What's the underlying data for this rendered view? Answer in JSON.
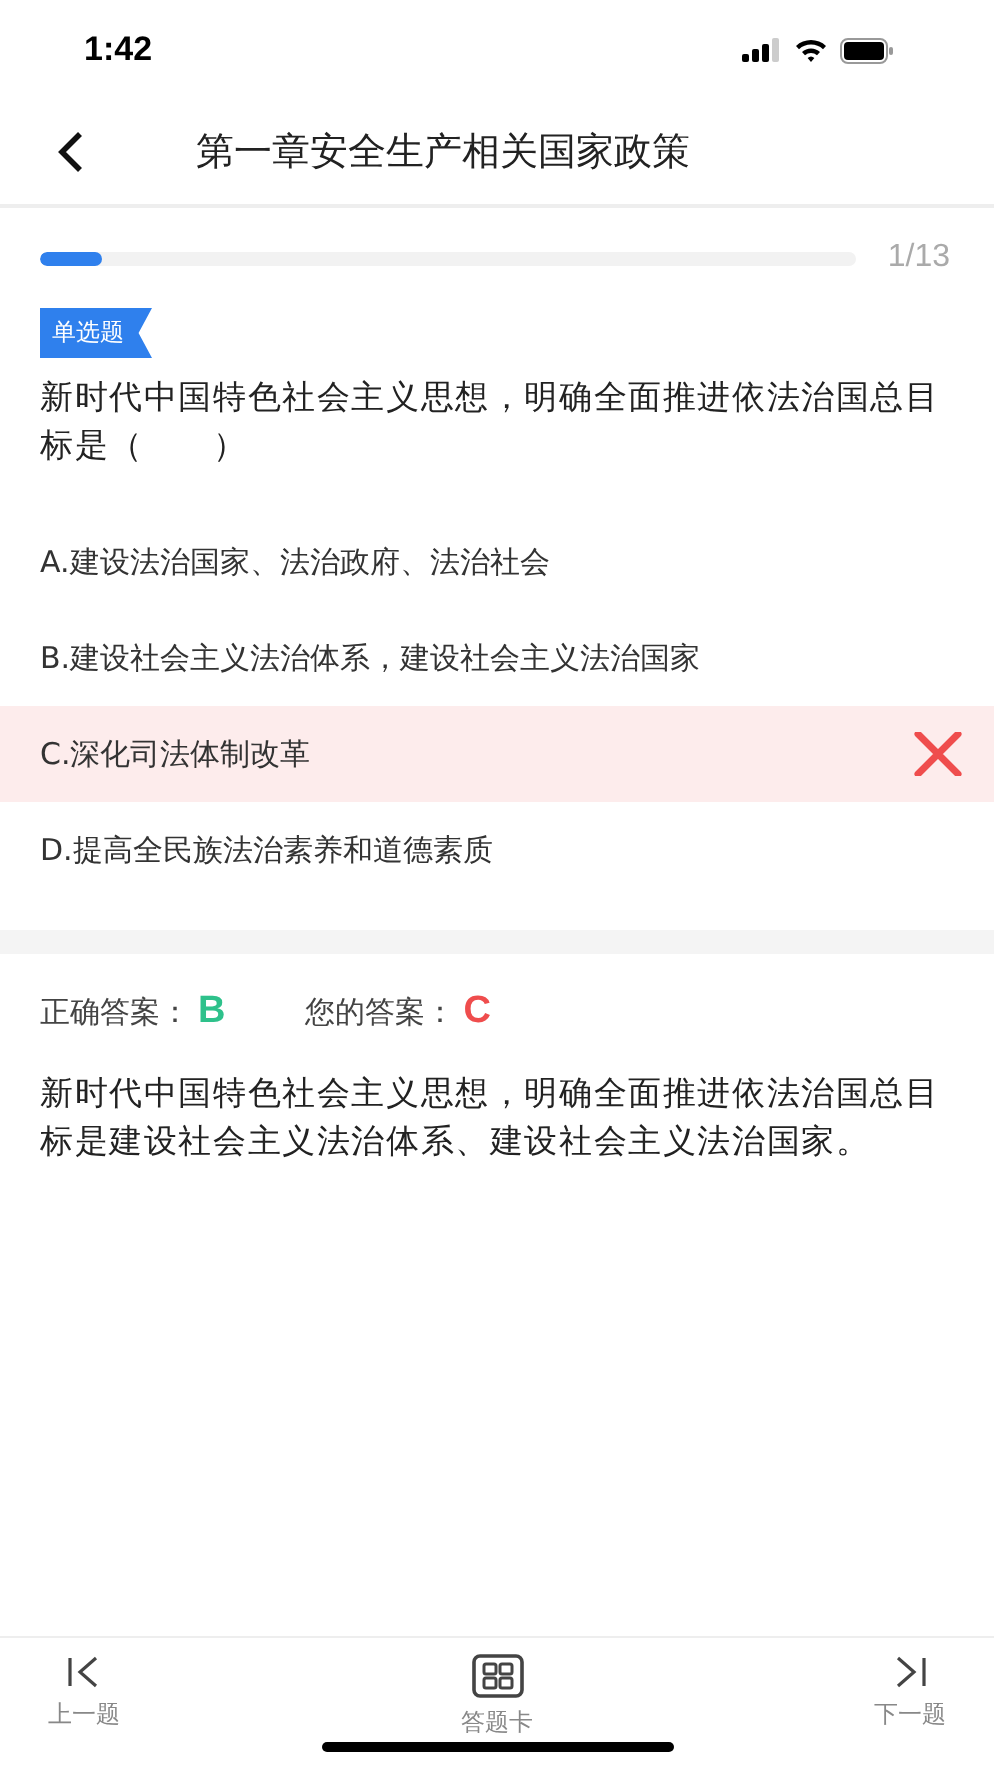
{
  "status_bar": {
    "time": "1:42"
  },
  "header": {
    "title": "第一章安全生产相关国家政策"
  },
  "progress": {
    "level": 0.077,
    "count": "1/13"
  },
  "question": {
    "type_tag": "单选题",
    "text": "新时代中国特色社会主义思想，明确全面推进依法治国总目标是（　　）"
  },
  "options": [
    {
      "label": "A.建设法治国家、法治政府、法治社会",
      "selected": false
    },
    {
      "label": "B.建设社会主义法治体系，建设社会主义法治国家",
      "selected": false
    },
    {
      "label": "C.深化司法体制改革",
      "selected": true
    },
    {
      "label": "D.提高全民族法治素养和道德素质",
      "selected": false
    }
  ],
  "answer": {
    "correct_label": "正确答案：",
    "correct": "B",
    "yours_label": "您的答案：",
    "yours": "C"
  },
  "explanation": "新时代中国特色社会主义思想，明确全面推进依法治国总目标是建设社会主义法治体系、建设社会主义法治国家。",
  "bottom_bar": [
    {
      "label": "上一题",
      "kind": "prev"
    },
    {
      "label": "答题卡",
      "kind": "card"
    },
    {
      "label": "下一题",
      "kind": "next"
    }
  ]
}
